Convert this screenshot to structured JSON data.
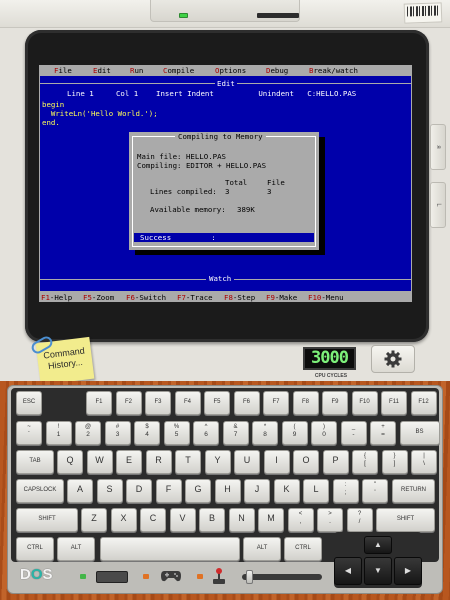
{
  "menubar": {
    "items": [
      {
        "hk": "F",
        "rest": "ile"
      },
      {
        "hk": "E",
        "rest": "dit"
      },
      {
        "hk": "R",
        "rest": "un"
      },
      {
        "hk": "C",
        "rest": "ompile"
      },
      {
        "hk": "O",
        "rest": "ptions"
      },
      {
        "hk": "D",
        "rest": "ebug"
      },
      {
        "hk": "B",
        "rest": "reak/watch"
      }
    ]
  },
  "editor": {
    "title": "Edit",
    "status_line": "Line 1     Col 1    Insert Indent          Unindent   C:HELLO.PAS",
    "code": [
      "begin",
      "  WriteLn('Hello World.');",
      "end."
    ]
  },
  "dialog": {
    "title": "Compiling to Memory",
    "main_file": "Main file: HELLO.PAS",
    "compiling": "Compiling: EDITOR + HELLO.PAS",
    "col_total": "Total",
    "col_file": "File",
    "lines_label": "Lines compiled:",
    "lines_total": "3",
    "lines_file": "3",
    "memory_label": "Available memory:",
    "memory_value": "389K",
    "result": "Success         :"
  },
  "watch": {
    "title": "Watch"
  },
  "fkeys": [
    {
      "hk": "F1",
      "rest": "-Help"
    },
    {
      "hk": "F5",
      "rest": "-Zoom"
    },
    {
      "hk": "F6",
      "rest": "-Switch"
    },
    {
      "hk": "F7",
      "rest": "-Trace"
    },
    {
      "hk": "F8",
      "rest": "-Step"
    },
    {
      "hk": "F9",
      "rest": "-Make"
    },
    {
      "hk": "F10",
      "rest": "-Menu"
    }
  ],
  "side_buttons": [
    "ᴙ",
    "L"
  ],
  "note": {
    "text": "Command History..."
  },
  "cpu": {
    "value": "3000",
    "label": "CPU CYCLES"
  },
  "settings": {
    "icon": "gear-icon"
  },
  "logo": {
    "d": "D",
    "o": "O",
    "s": "S"
  },
  "keyboard": {
    "row0": [
      "ESC",
      "F1",
      "F2",
      "F3",
      "F4",
      "F5",
      "F6",
      "F7",
      "F8",
      "F9",
      "F10",
      "F11",
      "F12"
    ],
    "row1": [
      {
        "t": "~",
        "b": "`"
      },
      {
        "t": "!",
        "b": "1"
      },
      {
        "t": "@",
        "b": "2"
      },
      {
        "t": "#",
        "b": "3"
      },
      {
        "t": "$",
        "b": "4"
      },
      {
        "t": "%",
        "b": "5"
      },
      {
        "t": "^",
        "b": "6"
      },
      {
        "t": "&",
        "b": "7"
      },
      {
        "t": "*",
        "b": "8"
      },
      {
        "t": "(",
        "b": "9"
      },
      {
        "t": ")",
        "b": "0"
      },
      {
        "t": "_",
        "b": "-"
      },
      {
        "t": "+",
        "b": "="
      },
      {
        "t": "BS",
        "b": ""
      }
    ],
    "row2": [
      "TAB",
      "Q",
      "W",
      "E",
      "R",
      "T",
      "Y",
      "U",
      "I",
      "O",
      "P",
      "{",
      "}",
      "|"
    ],
    "row2_sub": [
      "",
      "",
      "",
      "",
      "",
      "",
      "",
      "",
      "",
      "",
      "",
      "[",
      "]",
      "\\"
    ],
    "row3": [
      "CAPSLOCK",
      "A",
      "S",
      "D",
      "F",
      "G",
      "H",
      "J",
      "K",
      "L",
      ":",
      "\"",
      "RETURN"
    ],
    "row3_sub": [
      "",
      "",
      "",
      "",
      "",
      "",
      "",
      "",
      "",
      "",
      ";",
      "'",
      ""
    ],
    "row4": [
      "SHIFT",
      "Z",
      "X",
      "C",
      "V",
      "B",
      "N",
      "M",
      "<",
      ">",
      "?",
      "SHIFT"
    ],
    "row4_sub": [
      "",
      "",
      "",
      "",
      "",
      "",
      "",
      "",
      ",",
      ".",
      "/",
      ""
    ],
    "row5": [
      "CTRL",
      "ALT",
      "",
      "ALT",
      "CTRL"
    ]
  }
}
